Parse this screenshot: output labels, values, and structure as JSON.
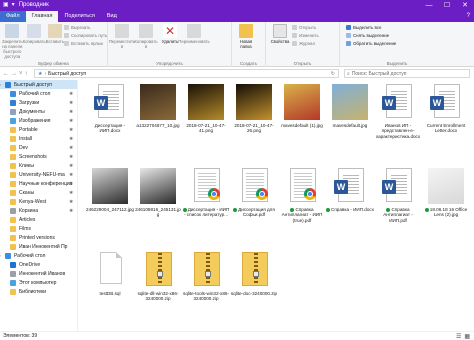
{
  "window": {
    "title": "Проводник",
    "controls": {
      "minimize": "—",
      "maximize": "☐",
      "close": "✕"
    }
  },
  "ribbon_tabs": [
    {
      "label": "Файл",
      "kind": "file"
    },
    {
      "label": "Главная",
      "kind": "active"
    },
    {
      "label": "Поделиться",
      "kind": "normal"
    },
    {
      "label": "Вид",
      "kind": "normal"
    }
  ],
  "ribbon_help": "?",
  "ribbon": {
    "clipboard": {
      "label": "Буфер обмена",
      "pin": "Закрепить на панели быстрого доступа",
      "copy": "Копировать",
      "paste": "Вставить",
      "cut": "Вырезать",
      "copy_path": "Скопировать путь",
      "paste_shortcut": "Вставить ярлык"
    },
    "organize": {
      "label": "Упорядочить",
      "move": "Переместить в",
      "copy_to": "Копировать в",
      "delete": "Удалить",
      "rename": "Переименовать"
    },
    "create": {
      "label": "Создать",
      "new_folder": "Новая папка"
    },
    "open": {
      "label": "Открыть",
      "properties": "Свойства",
      "open": "Открыть",
      "edit": "Изменить",
      "history": "Журнал"
    },
    "select": {
      "label": "Выделить",
      "select_all": "Выделить все",
      "select_none": "Снять выделение",
      "invert": "Обратить выделение"
    }
  },
  "address": {
    "path": "Быстрый доступ",
    "search_placeholder": "Поиск: Быстрый доступ"
  },
  "sidebar": [
    {
      "label": "Быстрый доступ",
      "top": true,
      "selected": true,
      "color": "#2f7fd6",
      "pin": false
    },
    {
      "label": "Рабочий стол",
      "color": "#3d8ee0",
      "pin": true
    },
    {
      "label": "Загрузки",
      "color": "#2f7fd6",
      "pin": true
    },
    {
      "label": "Документы",
      "color": "#8ca3c0",
      "pin": true
    },
    {
      "label": "Изображения",
      "color": "#4aa3df",
      "pin": true
    },
    {
      "label": "Portable",
      "color": "#f2c24f",
      "pin": true
    },
    {
      "label": "Install",
      "color": "#f2c24f",
      "pin": true
    },
    {
      "label": "Dev",
      "color": "#f2c24f",
      "pin": true
    },
    {
      "label": "Screenshots",
      "color": "#f2c24f",
      "pin": true
    },
    {
      "label": "Клиеы",
      "color": "#f2c24f",
      "pin": true
    },
    {
      "label": "University-NEFU-ma",
      "color": "#f2c24f",
      "pin": true
    },
    {
      "label": "Научные конференция",
      "color": "#f2c24f",
      "pin": true
    },
    {
      "label": "Сканы",
      "color": "#f2c24f",
      "pin": true
    },
    {
      "label": "Kenya-West",
      "color": "#f2c24f",
      "pin": true
    },
    {
      "label": "Корзина",
      "color": "#9aa0a6",
      "pin": true
    },
    {
      "label": "Articles",
      "color": "#f2c24f",
      "pin": false
    },
    {
      "label": "Films",
      "color": "#f2c24f",
      "pin": false
    },
    {
      "label": "Printed versions",
      "color": "#f2c24f",
      "pin": false
    },
    {
      "label": "Иван Иннокентий Пр",
      "color": "#f2c24f",
      "pin": false
    },
    {
      "label": "Рабочий стол",
      "top": true,
      "color": "#3d8ee0",
      "pin": false
    },
    {
      "label": "OneDrive",
      "color": "#1e73d2",
      "pin": false
    },
    {
      "label": "Иннокентий Иванов",
      "color": "#9aa0a6",
      "pin": false
    },
    {
      "label": "Этот компьютер",
      "color": "#4aa3df",
      "pin": false
    },
    {
      "label": "Библиотеки",
      "color": "#f2c24f",
      "pin": false
    }
  ],
  "files": [
    {
      "name": "Диссертация - ИИП.docx",
      "type": "word"
    },
    {
      "name": "a1322704677_10.jpg",
      "type": "photo",
      "colors": [
        "#3a2a1c",
        "#8a6a3a"
      ]
    },
    {
      "name": "2018-07-21_10-47-41.png",
      "type": "photo",
      "colors": [
        "#1a1208",
        "#b58b2a"
      ]
    },
    {
      "name": "2018-07-21_10-47-26.png",
      "type": "photo",
      "colors": [
        "#140e06",
        "#c4922e"
      ]
    },
    {
      "name": "mavesdefault (1).jpg",
      "type": "photo",
      "colors": [
        "#d9b24a",
        "#b3382a"
      ]
    },
    {
      "name": "mavesdefault.jpg",
      "type": "photo",
      "colors": [
        "#7fb0d8",
        "#c7b26e"
      ]
    },
    {
      "name": "Иванов ИП - представлен-е-характеристика.docx",
      "type": "word"
    },
    {
      "name": "Current Enrollment Letter.docx",
      "type": "word"
    },
    {
      "name": "246229004_247112.jpg",
      "type": "photo",
      "colors": [
        "#d6d6d6",
        "#2e2e2e"
      ]
    },
    {
      "name": "246108816_245131.jpg",
      "type": "photo",
      "colors": [
        "#e8e8e8",
        "#2a2a2a"
      ]
    },
    {
      "name": "Диссертация - ИИП - список литератур...",
      "type": "pdf",
      "synced": true
    },
    {
      "name": "Диссертация для Софьи.pdf",
      "type": "pdf",
      "synced": true
    },
    {
      "name": "Справка Антиплагиат - ИИП (true).pdf",
      "type": "pdf",
      "synced": true
    },
    {
      "name": "Справка - ИИП.docx",
      "type": "word",
      "synced": true
    },
    {
      "name": "Справка Антиплагиат - ИИП.pdf",
      "type": "word",
      "synced": true
    },
    {
      "name": "18.06.18 16 Office Lens (2).jpg",
      "type": "photo",
      "synced": true,
      "colors": [
        "#f4f4f4",
        "#d8d8d8"
      ]
    },
    {
      "name": "testDB.sql",
      "type": "sql"
    },
    {
      "name": "sqlite-dll-win32-x86-3240000.zip",
      "type": "zip"
    },
    {
      "name": "sqlite-tools-win32-x86-3240000.zip",
      "type": "zip"
    },
    {
      "name": "sqlite-doc-3240000.zip",
      "type": "zip"
    }
  ],
  "status": {
    "text": "Элементов: 39"
  }
}
